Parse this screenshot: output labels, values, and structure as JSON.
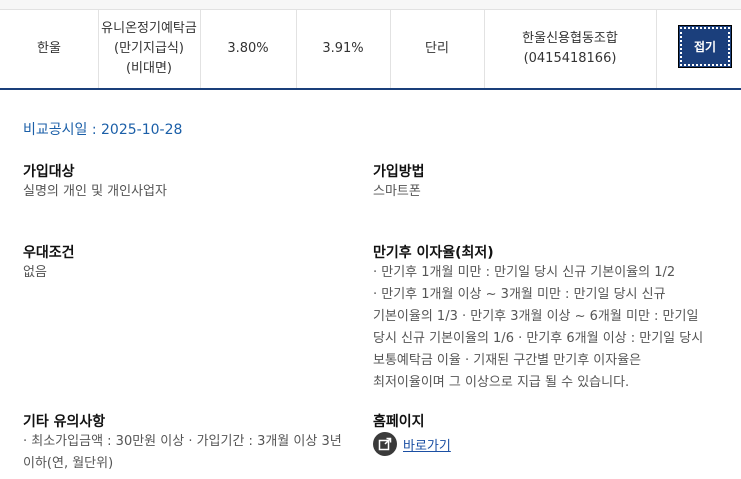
{
  "row": {
    "bank": "한울",
    "product_line1": "유니온정기예탁금",
    "product_line2": "(만기지급식)",
    "product_line3": "(비대면)",
    "rate_base": "3.80%",
    "rate_max": "3.91%",
    "interest_type": "단리",
    "contact_line1": "한울신용협동조합",
    "contact_line2": "(0415418166)",
    "toggle_label": "접기"
  },
  "detail": {
    "compare_date": "비교공시일 : 2025-10-28",
    "join_target_title": "가입대상",
    "join_target_value": "실명의 개인 및 개인사업자",
    "join_method_title": "가입방법",
    "join_method_value": "스마트폰",
    "preferential_title": "우대조건",
    "preferential_value": "없음",
    "maturity_title": "만기후 이자율(최저)",
    "maturity_lines": [
      "· 만기후 1개월 미만 : 만기일 당시 신규 기본이율의 1/2",
      "· 만기후 1개월 이상 ~ 3개월 미만 : 만기일 당시 신규",
      "기본이율의 1/3  · 만기후 3개월 이상 ~ 6개월 미만 : 만기일",
      "당시 신규 기본이율의 1/6  · 만기후 6개월 이상 : 만기일 당시",
      "보통예탁금 이율  · 기재된 구간별 만기후 이자율은",
      "최저이율이며 그 이상으로 지급 될 수 있습니다."
    ],
    "other_title": "기타 유의사항",
    "other_lines": [
      "· 최소가입금액 : 30만원 이상  · 가입기간 : 3개월 이상 3년",
      "이하(연, 월단위)"
    ],
    "homepage_title": "홈페이지",
    "homepage_link": "바로가기",
    "homepage_icon": "external-link-icon"
  }
}
